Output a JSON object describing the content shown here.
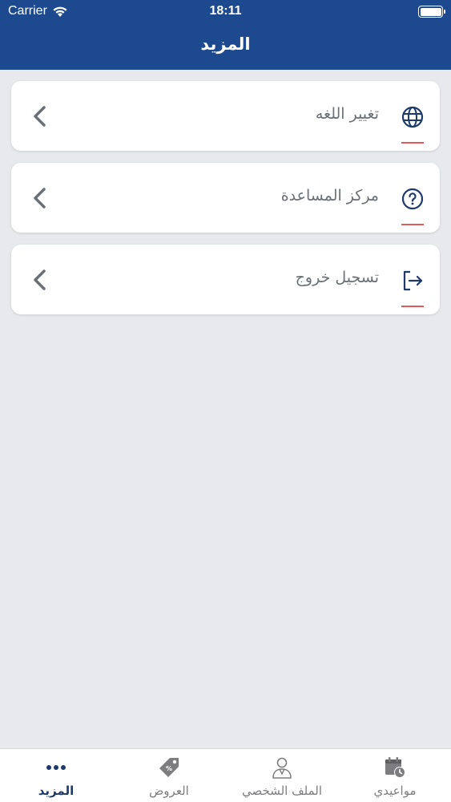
{
  "status_bar": {
    "carrier": "Carrier",
    "time": "18:11"
  },
  "header": {
    "title": "المزيد"
  },
  "menu": {
    "items": [
      {
        "label": "تغيير اللغه",
        "icon": "globe-icon"
      },
      {
        "label": "مركز المساعدة",
        "icon": "help-circle-icon"
      },
      {
        "label": "تسجيل خروج",
        "icon": "logout-icon"
      }
    ]
  },
  "tabbar": {
    "tabs": [
      {
        "label": "مواعيدي",
        "icon": "calendar-clock-icon",
        "active": false
      },
      {
        "label": "الملف الشخصي",
        "icon": "profile-icon",
        "active": false
      },
      {
        "label": "العروض",
        "icon": "tag-icon",
        "active": false
      },
      {
        "label": "المزيد",
        "icon": "more-dots-icon",
        "active": true
      }
    ]
  },
  "colors": {
    "header_bg": "#1d4a8f",
    "page_bg": "#e8e9ed",
    "accent_red": "#e05a5a",
    "icon_blue": "#1d3a6a",
    "label_gray": "#6b6f76",
    "tab_inactive": "#7d7d80"
  }
}
